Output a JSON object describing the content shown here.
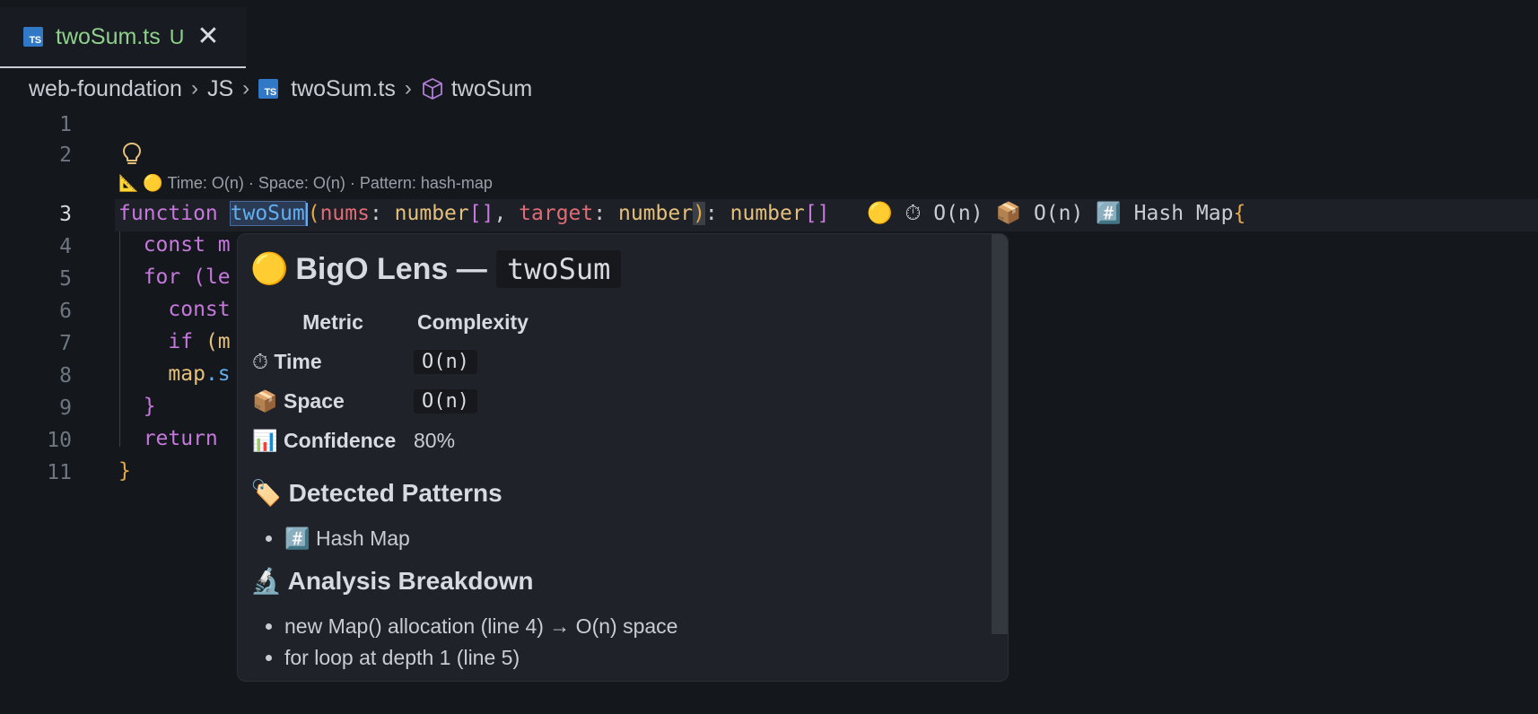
{
  "tab": {
    "file_name": "twoSum.ts",
    "status": "U",
    "icon": "typescript-file-icon"
  },
  "breadcrumb": {
    "root": "web-foundation",
    "folder": "JS",
    "file": "twoSum.ts",
    "symbol": "twoSum"
  },
  "editor": {
    "line_numbers": [
      "1",
      "2",
      "3",
      "4",
      "5",
      "6",
      "7",
      "8",
      "9",
      "10",
      "11"
    ],
    "active_line": "3",
    "codelens": "📐 🟡 Time: O(n) · Space: O(n) · Pattern: hash-map",
    "line3": {
      "kw_function": "function ",
      "fn_name": "twoSum",
      "lparen": "(",
      "p1": "nums",
      "c1": ": ",
      "t1": "number",
      "br1": "[]",
      "comma": ", ",
      "p2": "target",
      "c2": ": ",
      "t2": "number",
      "rparen": ")",
      "c3": ": ",
      "t3": "number",
      "br2": "[]",
      "inlay": "   🟡 ⏱ O(n) 📦 O(n) #️⃣ Hash Map",
      "brace": "{"
    },
    "line4": "  const m",
    "line5": {
      "kw": "  for ",
      "rest": "(le"
    },
    "line6": "    const",
    "line7": {
      "kw": "    if ",
      "rest": "(m"
    },
    "line8": {
      "obj": "    map",
      "rest": ".s"
    },
    "line9": "  }",
    "line10": "  return",
    "line11": "}"
  },
  "hover": {
    "title_emoji": "🟡",
    "title": "BigO Lens —",
    "title_code": "twoSum",
    "table_header": {
      "metric": "Metric",
      "complexity": "Complexity"
    },
    "rows": [
      {
        "emoji": "⏱",
        "label": "Time",
        "value": "O(n)"
      },
      {
        "emoji": "📦",
        "label": "Space",
        "value": "O(n)"
      },
      {
        "emoji": "📊",
        "label": "Confidence",
        "value": "80%"
      }
    ],
    "patterns_heading": "🏷️ Detected Patterns",
    "patterns": [
      "#️⃣ Hash Map"
    ],
    "breakdown_heading": "🔬 Analysis Breakdown",
    "breakdown": [
      "new Map() allocation (line 4) → O(n) space",
      "for loop at depth 1 (line 5)"
    ]
  },
  "colors": {
    "background": "#14171c",
    "keyword": "#c678dd",
    "function": "#61afef",
    "type": "#e5c07b",
    "param": "#e06c75",
    "tab_modified": "#8ed18a"
  }
}
